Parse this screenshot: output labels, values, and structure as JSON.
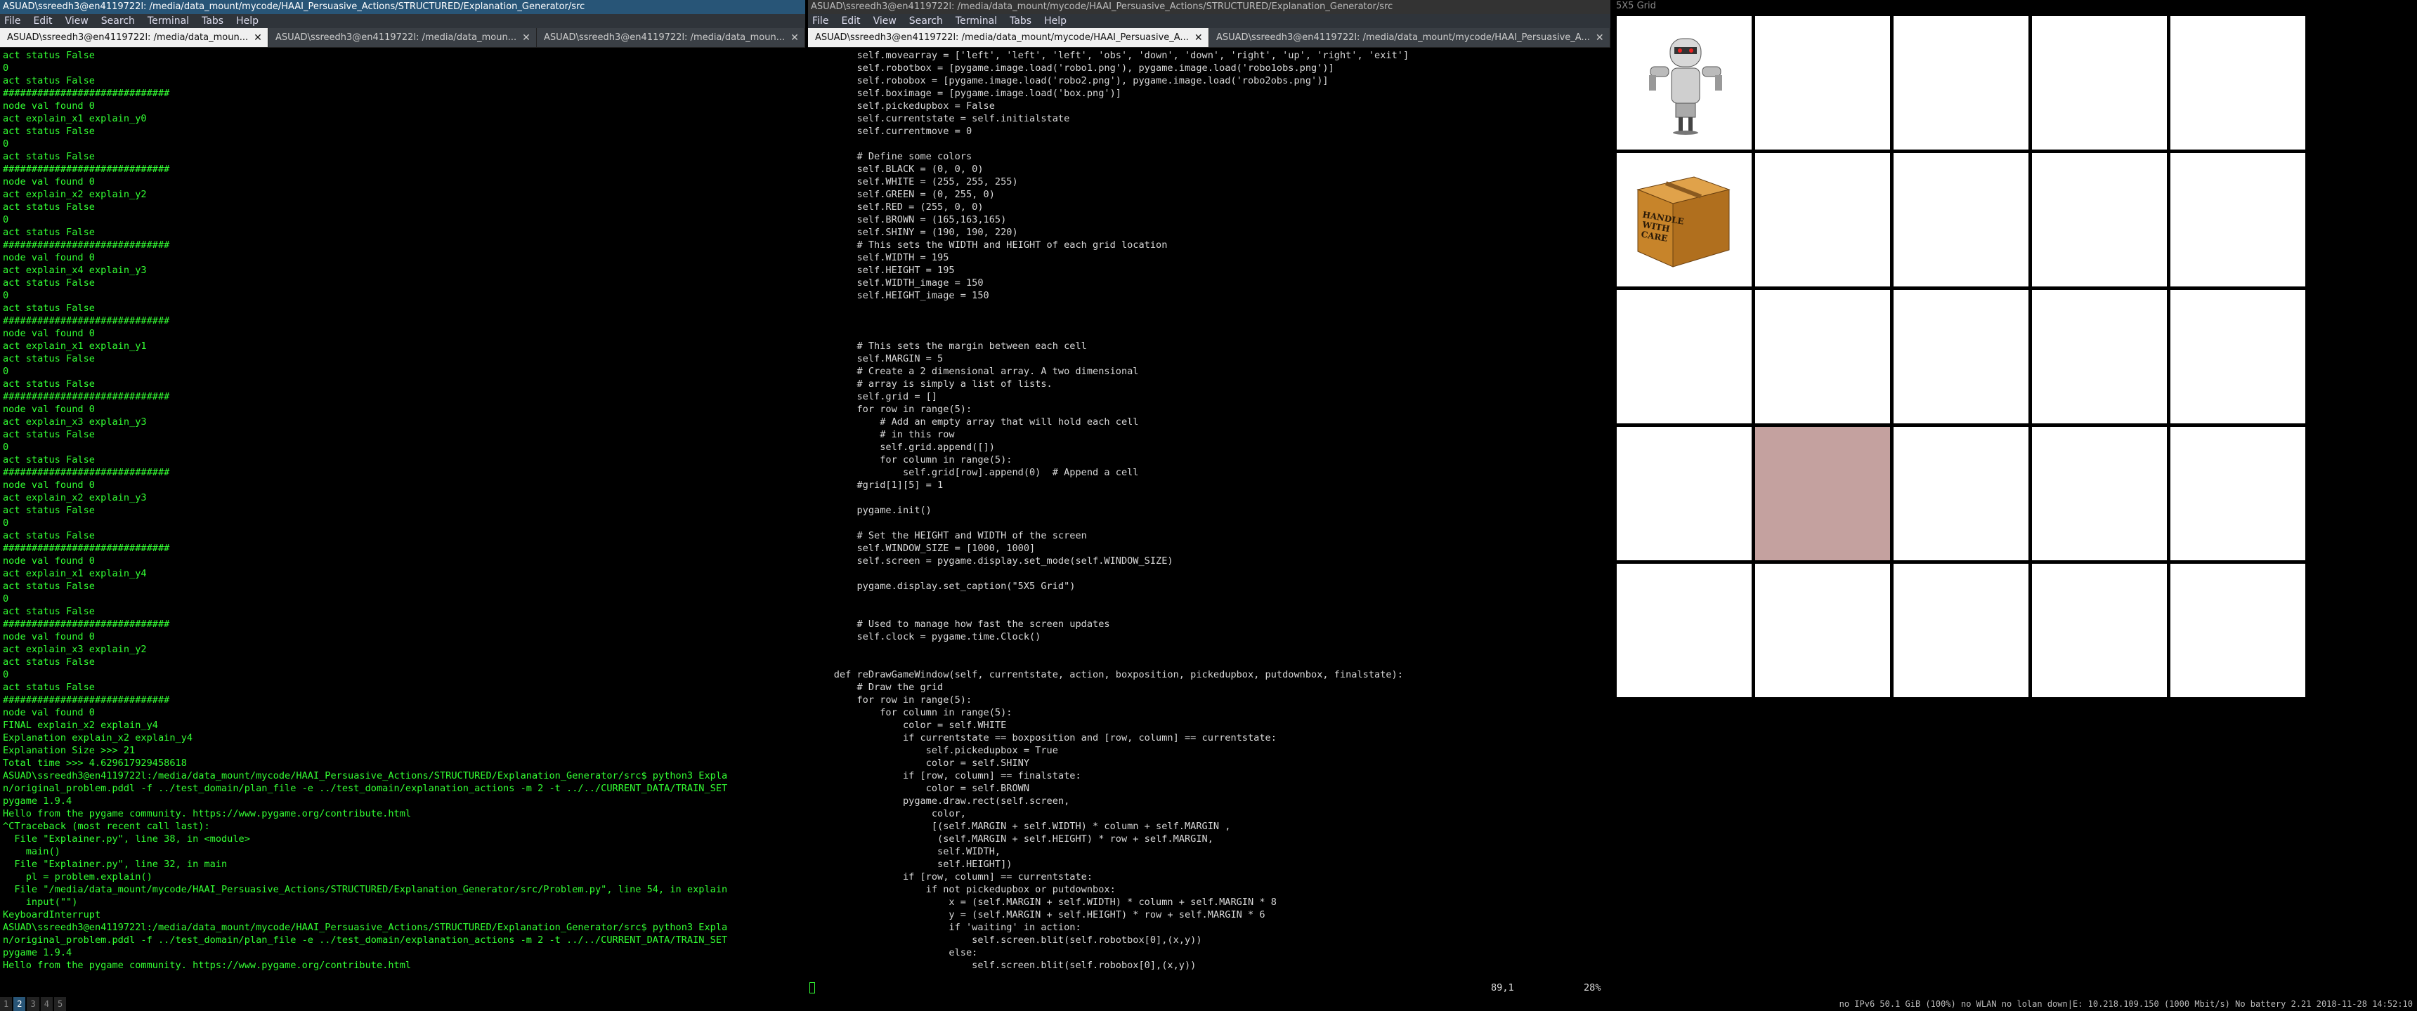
{
  "left_window": {
    "title": "ASUAD\\ssreedh3@en4119722l: /media/data_mount/mycode/HAAI_Persuasive_Actions/STRUCTURED/Explanation_Generator/src",
    "menu": [
      "File",
      "Edit",
      "View",
      "Search",
      "Terminal",
      "Tabs",
      "Help"
    ],
    "tabs": [
      {
        "label": "ASUAD\\ssreedh3@en4119722l: /media/data_moun...",
        "active": true
      },
      {
        "label": "ASUAD\\ssreedh3@en4119722l: /media/data_moun...",
        "active": false
      },
      {
        "label": "ASUAD\\ssreedh3@en4119722l: /media/data_moun...",
        "active": false
      }
    ],
    "lines": [
      "act status False",
      "0",
      "act status False",
      "#############################",
      "node val found 0",
      "act explain_x1 explain_y0",
      "act status False",
      "0",
      "act status False",
      "#############################",
      "node val found 0",
      "act explain_x2 explain_y2",
      "act status False",
      "0",
      "act status False",
      "#############################",
      "node val found 0",
      "act explain_x4 explain_y3",
      "act status False",
      "0",
      "act status False",
      "#############################",
      "node val found 0",
      "act explain_x1 explain_y1",
      "act status False",
      "0",
      "act status False",
      "#############################",
      "node val found 0",
      "act explain_x3 explain_y3",
      "act status False",
      "0",
      "act status False",
      "#############################",
      "node val found 0",
      "act explain_x2 explain_y3",
      "act status False",
      "0",
      "act status False",
      "#############################",
      "node val found 0",
      "act explain_x1 explain_y4",
      "act status False",
      "0",
      "act status False",
      "#############################",
      "node val found 0",
      "act explain_x3 explain_y2",
      "act status False",
      "0",
      "act status False",
      "#############################",
      "node val found 0",
      "FINAL explain_x2 explain_y4",
      "Explanation explain_x2 explain_y4",
      "Explanation Size >>> 21",
      "Total time >>> 4.629617929458618",
      "ASUAD\\ssreedh3@en4119722l:/media/data_mount/mycode/HAAI_Persuasive_Actions/STRUCTURED/Explanation_Generator/src$ python3 Expla",
      "n/original_problem.pddl -f ../test_domain/plan_file -e ../test_domain/explanation_actions -m 2 -t ../../CURRENT_DATA/TRAIN_SET",
      "pygame 1.9.4",
      "Hello from the pygame community. https://www.pygame.org/contribute.html",
      "^CTraceback (most recent call last):",
      "  File \"Explainer.py\", line 38, in <module>",
      "    main()",
      "  File \"Explainer.py\", line 32, in main",
      "    pl = problem.explain()",
      "  File \"/media/data_mount/mycode/HAAI_Persuasive_Actions/STRUCTURED/Explanation_Generator/src/Problem.py\", line 54, in explain",
      "    input(\"\")",
      "KeyboardInterrupt",
      "ASUAD\\ssreedh3@en4119722l:/media/data_mount/mycode/HAAI_Persuasive_Actions/STRUCTURED/Explanation_Generator/src$ python3 Expla",
      "n/original_problem.pddl -f ../test_domain/plan_file -e ../test_domain/explanation_actions -m 2 -t ../../CURRENT_DATA/TRAIN_SET",
      "pygame 1.9.4",
      "Hello from the pygame community. https://www.pygame.org/contribute.html"
    ]
  },
  "middle_window": {
    "title": "ASUAD\\ssreedh3@en4119722l: /media/data_mount/mycode/HAAI_Persuasive_Actions/STRUCTURED/Explanation_Generator/src",
    "menu": [
      "File",
      "Edit",
      "View",
      "Search",
      "Terminal",
      "Tabs",
      "Help"
    ],
    "tabs": [
      {
        "label": "ASUAD\\ssreedh3@en4119722l: /media/data_mount/mycode/HAAI_Persuasive_A...",
        "active": true
      },
      {
        "label": "ASUAD\\ssreedh3@en4119722l: /media/data_mount/mycode/HAAI_Persuasive_A...",
        "active": false
      }
    ],
    "lines": [
      "        self.movearray = ['left', 'left', 'left', 'obs', 'down', 'down', 'right', 'up', 'right', 'exit']",
      "        self.robotbox = [pygame.image.load('robo1.png'), pygame.image.load('robo1obs.png')]",
      "        self.robobox = [pygame.image.load('robo2.png'), pygame.image.load('robo2obs.png')]",
      "        self.boximage = [pygame.image.load('box.png')]",
      "        self.pickedupbox = False",
      "        self.currentstate = self.initialstate",
      "        self.currentmove = 0",
      "",
      "        # Define some colors",
      "        self.BLACK = (0, 0, 0)",
      "        self.WHITE = (255, 255, 255)",
      "        self.GREEN = (0, 255, 0)",
      "        self.RED = (255, 0, 0)",
      "        self.BROWN = (165,163,165)",
      "        self.SHINY = (190, 190, 220)",
      "        # This sets the WIDTH and HEIGHT of each grid location",
      "        self.WIDTH = 195",
      "        self.HEIGHT = 195",
      "        self.WIDTH_image = 150",
      "        self.HEIGHT_image = 150",
      "",
      "",
      "",
      "        # This sets the margin between each cell",
      "        self.MARGIN = 5",
      "        # Create a 2 dimensional array. A two dimensional",
      "        # array is simply a list of lists.",
      "        self.grid = []",
      "        for row in range(5):",
      "            # Add an empty array that will hold each cell",
      "            # in this row",
      "            self.grid.append([])",
      "            for column in range(5):",
      "                self.grid[row].append(0)  # Append a cell",
      "        #grid[1][5] = 1",
      "",
      "        pygame.init()",
      "",
      "        # Set the HEIGHT and WIDTH of the screen",
      "        self.WINDOW_SIZE = [1000, 1000]",
      "        self.screen = pygame.display.set_mode(self.WINDOW_SIZE)",
      "",
      "        pygame.display.set_caption(\"5X5 Grid\")",
      "",
      "",
      "        # Used to manage how fast the screen updates",
      "        self.clock = pygame.time.Clock()",
      "",
      "",
      "    def reDrawGameWindow(self, currentstate, action, boxposition, pickedupbox, putdownbox, finalstate):",
      "        # Draw the grid",
      "        for row in range(5):",
      "            for column in range(5):",
      "                color = self.WHITE",
      "                if currentstate == boxposition and [row, column] == currentstate:",
      "                    self.pickedupbox = True",
      "                    color = self.SHINY",
      "                if [row, column] == finalstate:",
      "                    color = self.BROWN",
      "                pygame.draw.rect(self.screen,",
      "                     color,",
      "                     [(self.MARGIN + self.WIDTH) * column + self.MARGIN ,",
      "                      (self.MARGIN + self.HEIGHT) * row + self.MARGIN,",
      "                      self.WIDTH,",
      "                      self.HEIGHT])",
      "                if [row, column] == currentstate:",
      "                    if not pickedupbox or putdownbox:",
      "                        x = (self.MARGIN + self.WIDTH) * column + self.MARGIN * 8",
      "                        y = (self.MARGIN + self.HEIGHT) * row + self.MARGIN * 6",
      "                        if 'waiting' in action:",
      "                            self.screen.blit(self.robotbox[0],(x,y))",
      "                        else:",
      "                            self.screen.blit(self.robobox[0],(x,y))"
    ],
    "cursor_pos": "89,1",
    "scroll_pct": "28%"
  },
  "grid_window": {
    "title": "5X5 Grid",
    "box_label": "HANDLE WITH CARE",
    "colors": {
      "white": "#ffffff",
      "brown": "#c4a19f",
      "bg": "#000000"
    }
  },
  "status_bar": {
    "workspaces": [
      "1",
      "2",
      "3",
      "4",
      "5"
    ],
    "right_text": "no IPv6  50.1 GiB  (100%) no WLAN  no lolan  down|E: 10.218.109.150 (1000 Mbit/s)  No battery  2.21  2018-11-28 14:52:10"
  }
}
